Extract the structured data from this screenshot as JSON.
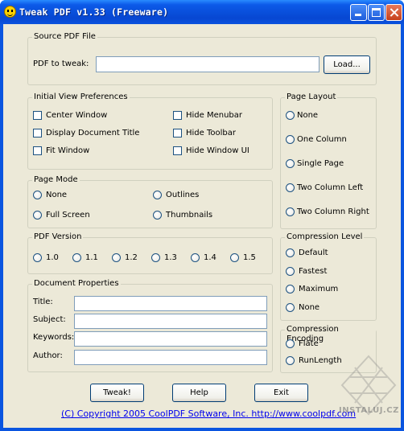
{
  "window": {
    "title": "Tweak PDF v1.33 (Freeware)"
  },
  "source": {
    "legend": "Source PDF File",
    "pdf_label": "PDF to tweak:",
    "pdf_value": "",
    "load_label": "Load..."
  },
  "initial_view": {
    "legend": "Initial View Preferences",
    "left": [
      "Center Window",
      "Display Document Title",
      "Fit Window"
    ],
    "right": [
      "Hide Menubar",
      "Hide Toolbar",
      "Hide Window UI"
    ]
  },
  "page_layout": {
    "legend": "Page Layout",
    "options": [
      "None",
      "One Column",
      "Single Page",
      "Two Column Left",
      "Two Column Right"
    ]
  },
  "page_mode": {
    "legend": "Page Mode",
    "left": [
      "None",
      "Full Screen"
    ],
    "right": [
      "Outlines",
      "Thumbnails"
    ]
  },
  "pdf_version": {
    "legend": "PDF Version",
    "options": [
      "1.0",
      "1.1",
      "1.2",
      "1.3",
      "1.4",
      "1.5"
    ]
  },
  "compression_level": {
    "legend": "Compression Level",
    "options": [
      "Default",
      "Fastest",
      "Maximum",
      "None"
    ]
  },
  "doc_props": {
    "legend": "Document Properties",
    "fields": [
      {
        "label": "Title:",
        "value": ""
      },
      {
        "label": "Subject:",
        "value": ""
      },
      {
        "label": "Keywords:",
        "value": ""
      },
      {
        "label": "Author:",
        "value": ""
      }
    ]
  },
  "compression_encoding": {
    "legend": "Compression Encoding",
    "options": [
      "Flate",
      "RunLength"
    ]
  },
  "buttons": {
    "tweak": "Tweak!",
    "help": "Help",
    "exit": "Exit"
  },
  "footer": {
    "link_text": "(C) Copyright 2005 CoolPDF Software, Inc.   http://www.coolpdf.com"
  },
  "watermark": {
    "text": "INSTALUJ.CZ"
  }
}
